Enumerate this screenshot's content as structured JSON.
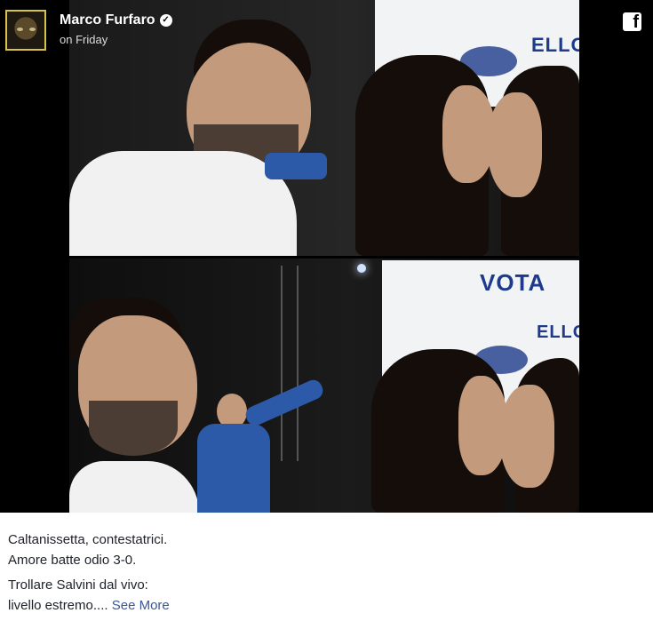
{
  "post": {
    "author": "Marco Furfaro",
    "time": "on Friday",
    "caption_line1": "Caltanissetta, contestatrici.",
    "caption_line2": "Amore batte odio 3-0.",
    "caption_line3": "Trollare Salvini dal vivo:",
    "caption_line4_text": "livello estremo....",
    "see_more": "See More"
  },
  "photos": {
    "top_banner_text": "ELLO",
    "bottom_banner_text": "VOTA",
    "bottom_banner_text2": "ELLO"
  },
  "icons": {
    "verified": "verified-badge-icon",
    "platform": "facebook-icon"
  },
  "colors": {
    "media_bg": "#000000",
    "link": "#385898",
    "text": "#1d2129"
  }
}
